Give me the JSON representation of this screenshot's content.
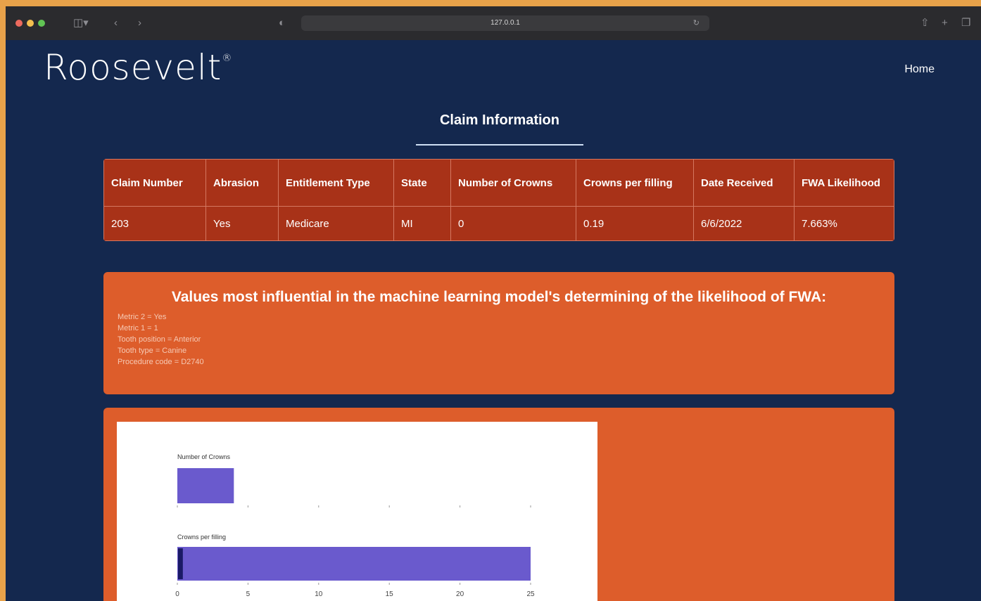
{
  "browser": {
    "url": "127.0.0.1",
    "nav_icons": [
      "sidebar-icon",
      "back-icon",
      "forward-icon",
      "privacy-icon",
      "reload-icon",
      "share-icon",
      "new-tab-icon",
      "tabs-icon"
    ]
  },
  "header": {
    "logo": "Roosevelt",
    "logo_mark": "®",
    "nav_home": "Home"
  },
  "page_title": "Claim Information",
  "claim_table": {
    "headers": [
      "Claim Number",
      "Abrasion",
      "Entitlement Type",
      "State",
      "Number of Crowns",
      "Crowns per filling",
      "Date Received",
      "FWA Likelihood"
    ],
    "row": [
      "203",
      "Yes",
      "Medicare",
      "MI",
      "0",
      "0.19",
      "6/6/2022",
      "7.663%"
    ]
  },
  "influence": {
    "title": "Values most influential in the machine learning model's determining of the likelihood of FWA:",
    "items": [
      "Metric 2 = Yes",
      "Metric 1 = 1",
      "Tooth position = Anterior",
      "Tooth type = Canine",
      "Procedure code = D2740"
    ]
  },
  "colors": {
    "page_bg": "#14284e",
    "table_bg": "#a83218",
    "panel_bg": "#dd5d2b",
    "bar_fill": "#6a5acd",
    "marker": "#1a1a66"
  },
  "chart_data": [
    {
      "type": "bar",
      "title": "Number of Crowns",
      "range_bar": [
        0,
        4
      ],
      "xlim": [
        0,
        25
      ],
      "ticks": [
        0,
        5,
        10,
        15,
        20,
        25
      ],
      "tick_labels_visible": false
    },
    {
      "type": "bar",
      "title": "Crowns per filling",
      "range_bar": [
        0,
        25
      ],
      "marker": 0.19,
      "xlim": [
        0,
        25
      ],
      "ticks": [
        0,
        5,
        10,
        15,
        20,
        25
      ],
      "tick_labels_visible": true
    }
  ]
}
